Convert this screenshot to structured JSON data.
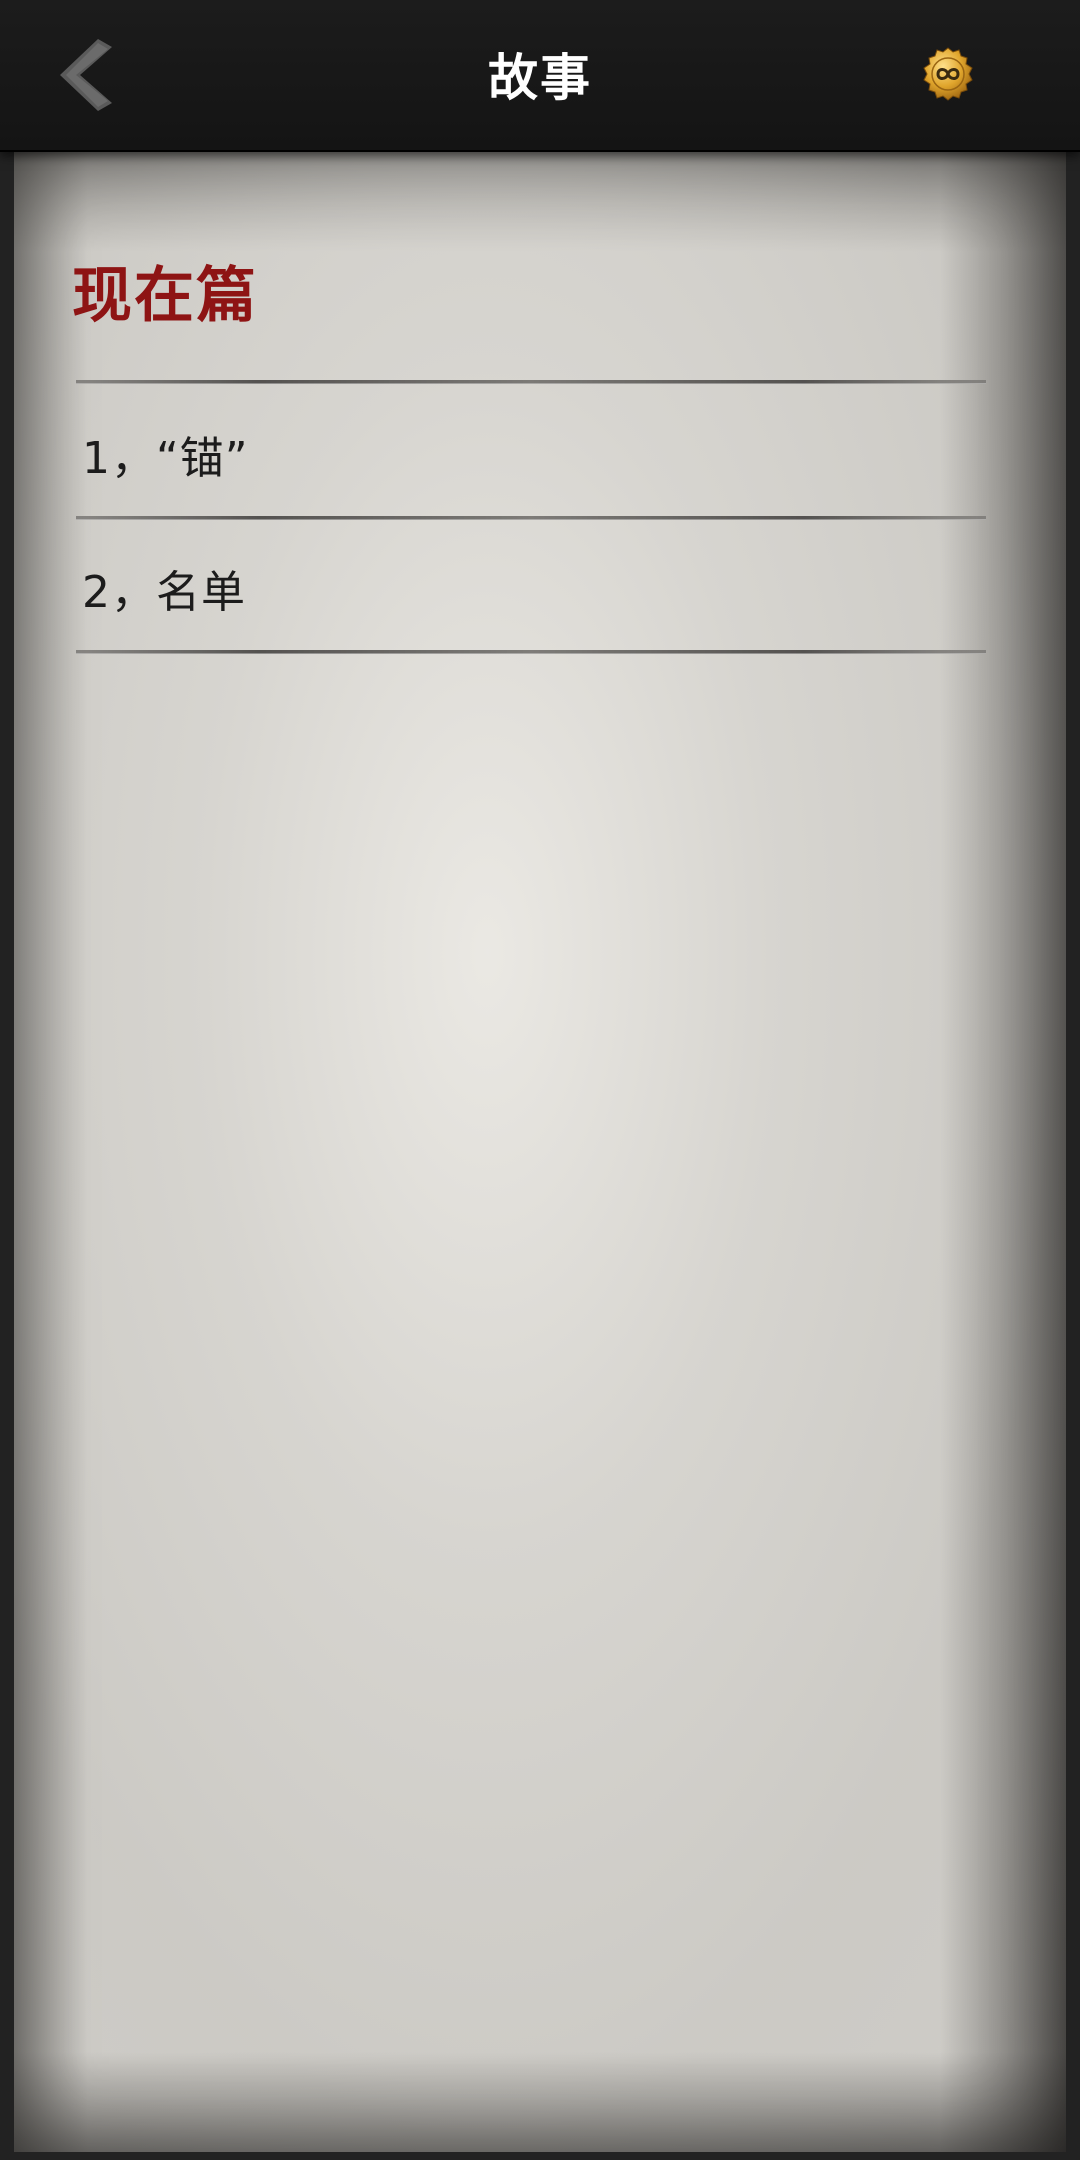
{
  "header": {
    "title": "故事",
    "back_icon": "chevron-left-icon",
    "badge_icon": "infinity-coin-icon",
    "badge_color": "#d9a12b"
  },
  "section": {
    "title": "现在篇",
    "title_color": "#8e1414"
  },
  "chapters": [
    {
      "label": "1，“锚”"
    },
    {
      "label": "2，名单"
    }
  ]
}
